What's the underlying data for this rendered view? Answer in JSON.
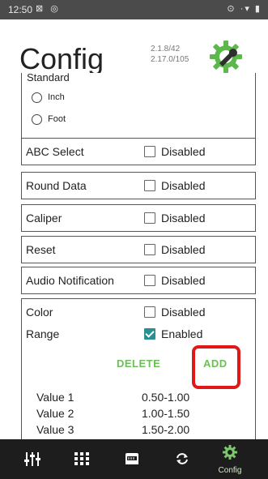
{
  "status_bar": {
    "time": "12:50",
    "notification_icons": "⊠ ◎",
    "right_icons": "⊙ ·▾ ▮"
  },
  "header": {
    "title": "Config",
    "version_1": "2.1.8/42",
    "version_2": "2.17.0/105",
    "logo_icon": "config-wrench-gear-icon"
  },
  "units": {
    "label": "Standard",
    "options": [
      {
        "label": "Inch",
        "selected": false
      },
      {
        "label": "Foot",
        "selected": false
      }
    ]
  },
  "settings": [
    {
      "label": "ABC Select",
      "checkbox_label": "Disabled",
      "checked": false
    },
    {
      "label": "Round Data",
      "checkbox_label": "Disabled",
      "checked": false
    },
    {
      "label": "Caliper",
      "checkbox_label": "Disabled",
      "checked": false
    },
    {
      "label": "Reset",
      "checkbox_label": "Disabled",
      "checked": false
    },
    {
      "label": "Audio Notification",
      "checkbox_label": "Disabled",
      "checked": false
    }
  ],
  "color_section": {
    "color_label": "Color",
    "color_checkbox_label": "Disabled",
    "color_checked": false,
    "range_label": "Range",
    "range_checkbox_label": "Enabled",
    "range_checked": true,
    "delete_label": "DELETE",
    "add_label": "ADD",
    "ranges": [
      {
        "name": "Value 1",
        "range": "0.50-1.00"
      },
      {
        "name": "Value 2",
        "range": "1.00-1.50"
      },
      {
        "name": "Value 3",
        "range": "1.50-2.00"
      }
    ]
  },
  "colors": {
    "status_bar": "#4b4b4b",
    "nav_bar": "#1d1d1d",
    "accent_green": "#6cbf58",
    "checkbox_checked": "#2a8f8f",
    "highlight_red": "#e01818"
  },
  "nav": {
    "items": [
      {
        "icon": "sliders-icon"
      },
      {
        "icon": "grid-icon"
      },
      {
        "icon": "device-icon"
      },
      {
        "icon": "sync-icon"
      },
      {
        "icon": "gear-icon",
        "label": "Config",
        "active": true
      }
    ]
  }
}
